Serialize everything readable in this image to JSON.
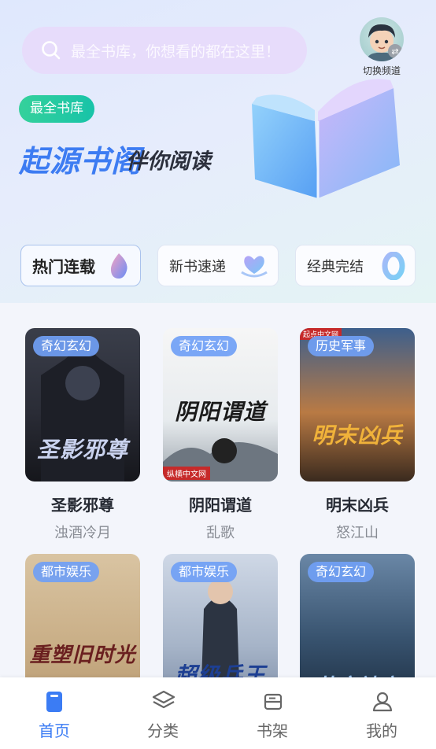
{
  "search": {
    "placeholder": "最全书库，你想看的都在这里！"
  },
  "channel_switch": {
    "label": "切换频道"
  },
  "banner": {
    "tag": "最全书库",
    "slogan_main": "起源书阁",
    "slogan_sub": "伴你阅读"
  },
  "channels": [
    {
      "label": "热门连载",
      "active": true
    },
    {
      "label": "新书速递",
      "active": false
    },
    {
      "label": "经典完结",
      "active": false
    }
  ],
  "books": [
    {
      "title": "圣影邪尊",
      "author": "浊酒冷月",
      "genre": "奇幻玄幻",
      "cover_text": "圣影邪尊"
    },
    {
      "title": "阴阳谓道",
      "author": "乱歌",
      "genre": "奇幻玄幻",
      "cover_text": "阴阳谓道"
    },
    {
      "title": "明末凶兵",
      "author": "怒江山",
      "genre": "历史军事",
      "cover_text": "明末凶兵"
    },
    {
      "title": "",
      "author": "",
      "genre": "都市娱乐",
      "cover_text": "重塑旧时光"
    },
    {
      "title": "",
      "author": "",
      "genre": "都市娱乐",
      "cover_text": "超级兵王"
    },
    {
      "title": "",
      "author": "",
      "genre": "奇幻玄幻",
      "cover_text": "苍穹神帝"
    }
  ],
  "cover_publisher_marks": [
    "纵横中文网",
    "起点中文网"
  ],
  "tabs": [
    {
      "label": "首页",
      "icon": "home-icon",
      "active": true
    },
    {
      "label": "分类",
      "icon": "layers-icon",
      "active": false
    },
    {
      "label": "书架",
      "icon": "bookshelf-icon",
      "active": false
    },
    {
      "label": "我的",
      "icon": "user-icon",
      "active": false
    }
  ],
  "colors": {
    "accent": "#3b7cf4",
    "tag_green": "#1fc8a3",
    "genre_badge": "#70a0f5"
  }
}
